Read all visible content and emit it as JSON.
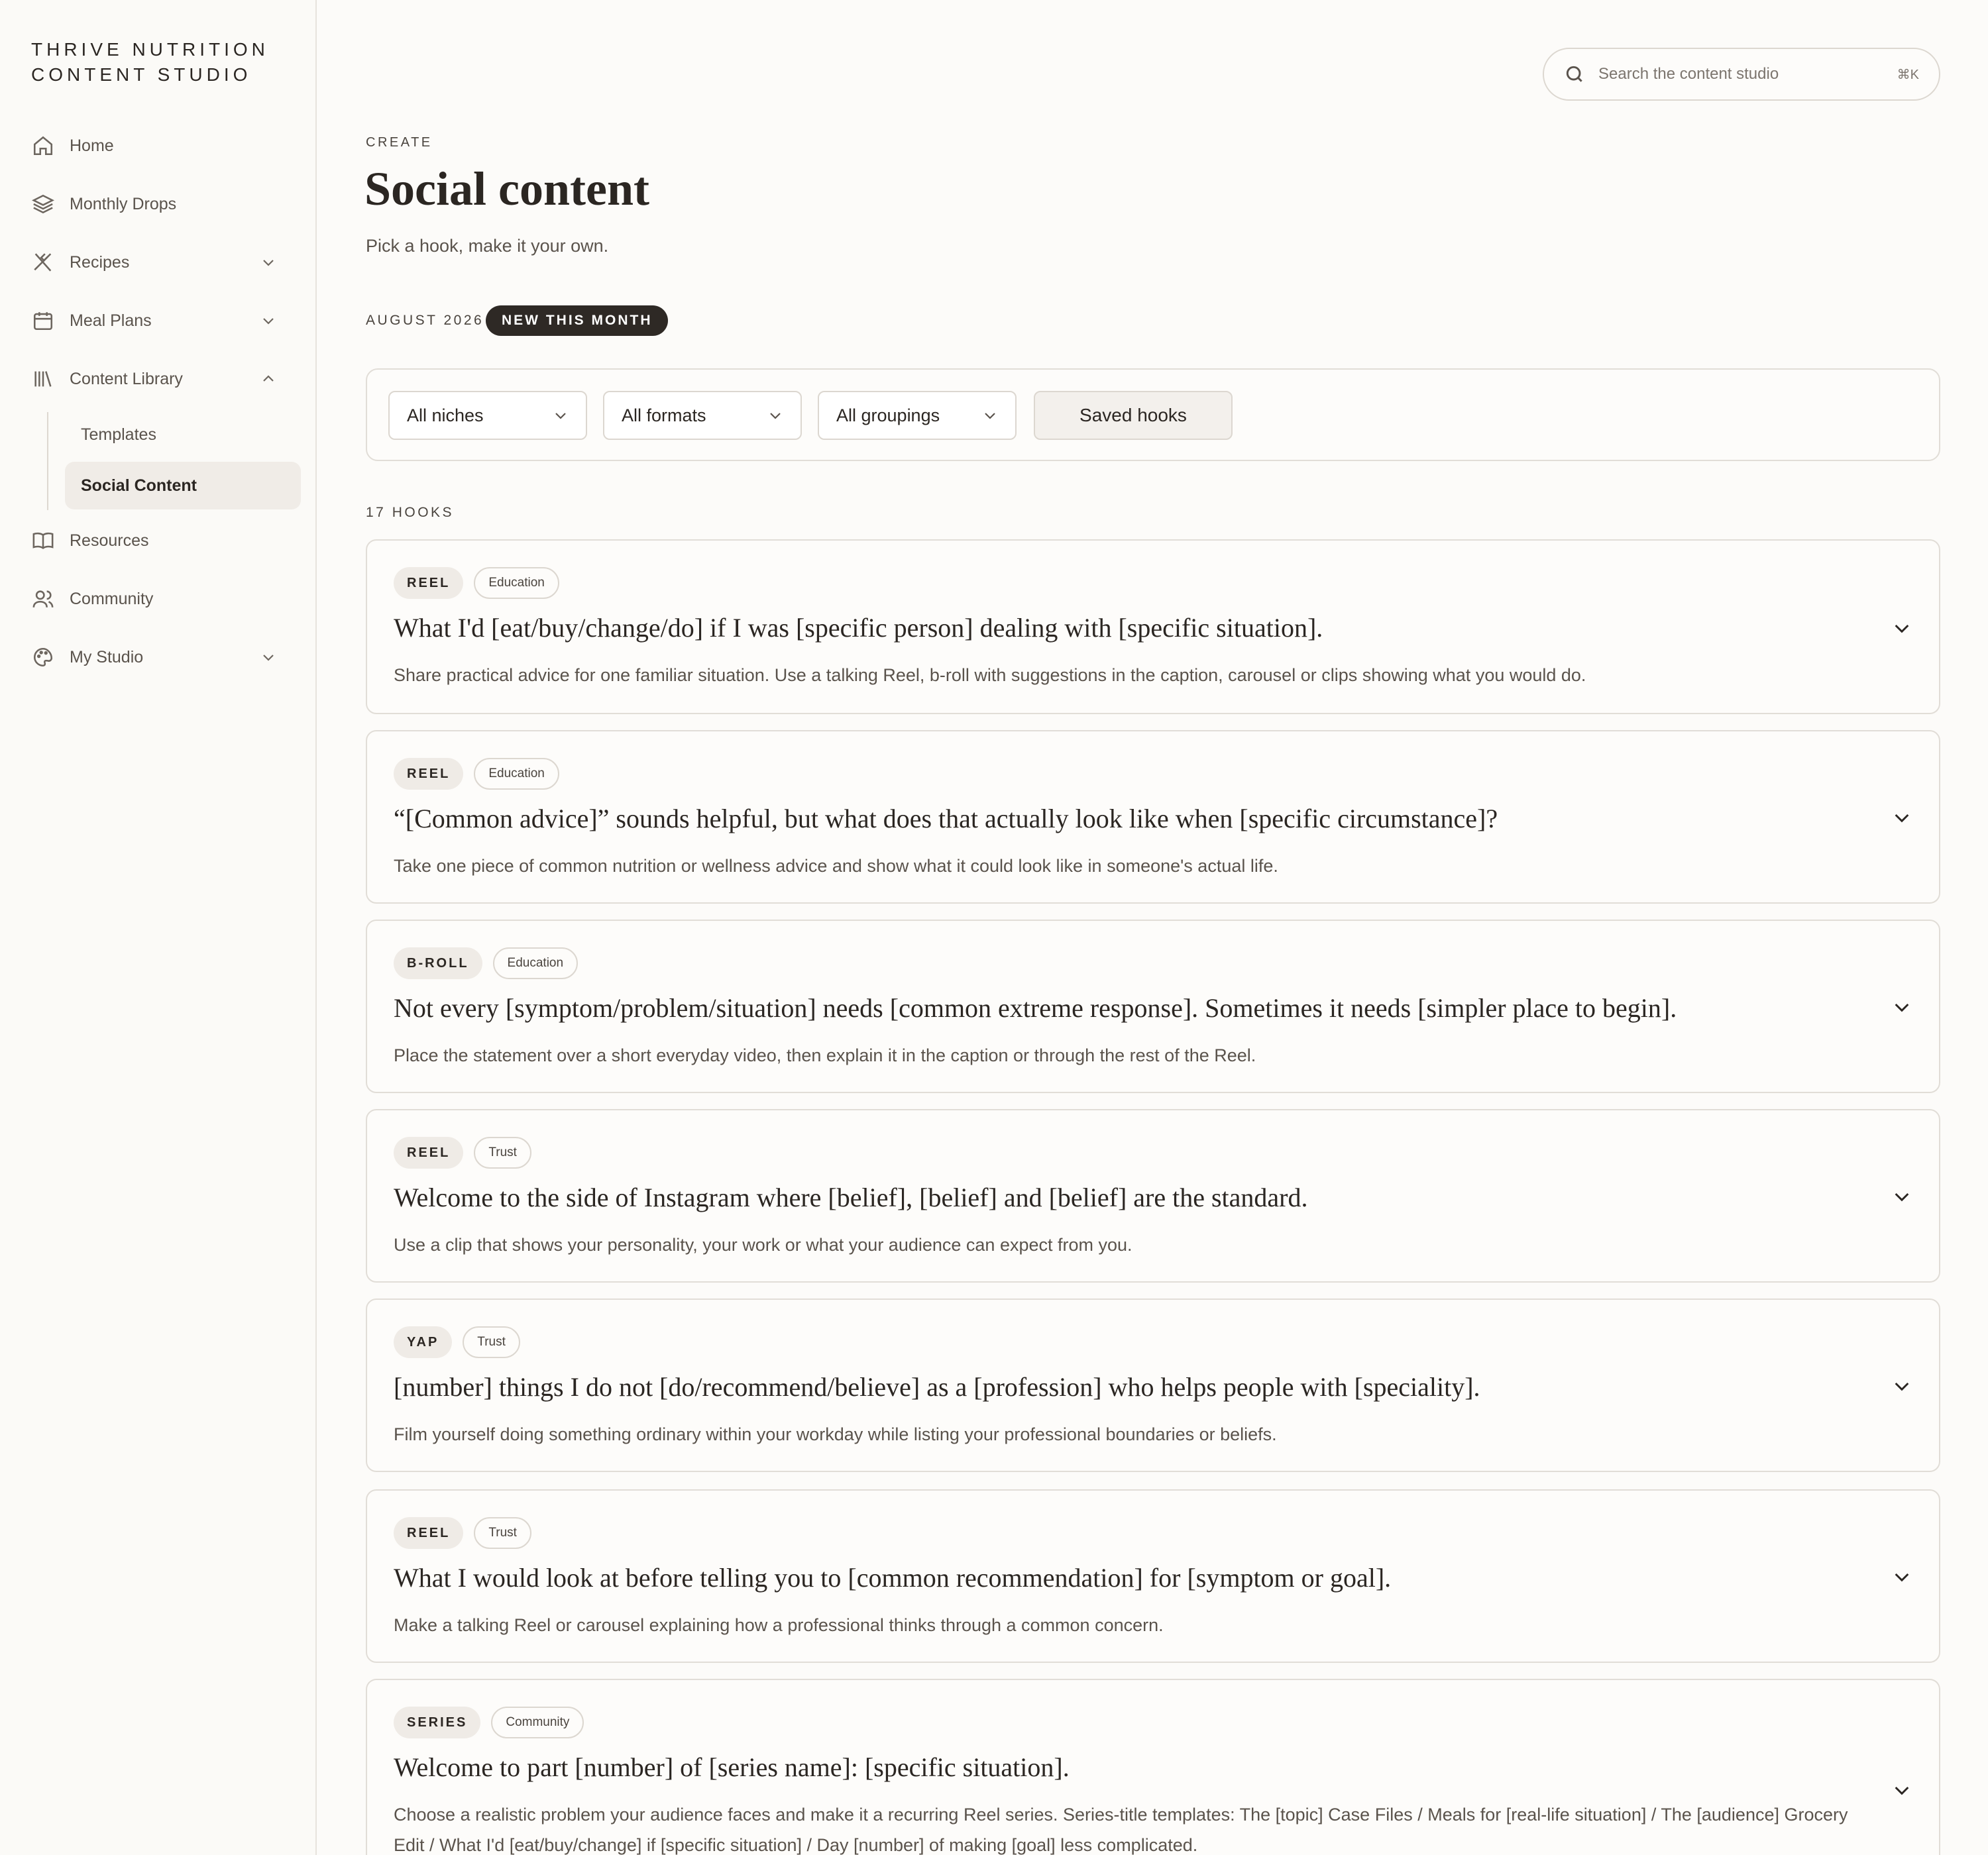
{
  "brand": {
    "line1": "THRIVE NUTRITION",
    "line2": "CONTENT STUDIO"
  },
  "sidebar": {
    "items": [
      {
        "label": "Home",
        "icon": "home-icon"
      },
      {
        "label": "Monthly Drops",
        "icon": "layers-icon"
      },
      {
        "label": "Recipes",
        "icon": "utensils-icon",
        "expandable": true
      },
      {
        "label": "Meal Plans",
        "icon": "calendar-icon",
        "expandable": true
      },
      {
        "label": "Content Library",
        "icon": "library-icon",
        "expanded": true
      },
      {
        "label": "Resources",
        "icon": "book-icon"
      },
      {
        "label": "Community",
        "icon": "users-icon"
      },
      {
        "label": "My Studio",
        "icon": "palette-icon",
        "expandable": true
      }
    ],
    "subitems": [
      {
        "label": "Templates"
      },
      {
        "label": "Social Content",
        "active": true
      }
    ]
  },
  "search": {
    "placeholder": "Search the content studio",
    "shortcut": "⌘K"
  },
  "header": {
    "eyebrow": "CREATE",
    "title": "Social content",
    "subtitle": "Pick a hook, make it your own.",
    "month": "AUGUST 2026",
    "badge": "NEW THIS MONTH"
  },
  "filters": {
    "niche": "All niches",
    "format": "All formats",
    "grouping": "All groupings",
    "saved": "Saved hooks"
  },
  "count_label": "17 HOOKS",
  "hooks": [
    {
      "format": "REEL",
      "category": "Education",
      "hook": "What I'd [eat/buy/change/do] if I was [specific person] dealing with [specific situation].",
      "desc": "Share practical advice for one familiar situation. Use a talking Reel, b-roll with suggestions in the caption, carousel or clips showing what you would do."
    },
    {
      "format": "REEL",
      "category": "Education",
      "hook": "“[Common advice]” sounds helpful, but what does that actually look like when [specific circumstance]?",
      "desc": "Take one piece of common nutrition or wellness advice and show what it could look like in someone's actual life."
    },
    {
      "format": "B-ROLL",
      "category": "Education",
      "hook": "Not every [symptom/problem/situation] needs [common extreme response]. Sometimes it needs [simpler place to begin].",
      "desc": "Place the statement over a short everyday video, then explain it in the caption or through the rest of the Reel."
    },
    {
      "format": "REEL",
      "category": "Trust",
      "hook": "Welcome to the side of Instagram where [belief], [belief] and [belief] are the standard.",
      "desc": "Use a clip that shows your personality, your work or what your audience can expect from you."
    },
    {
      "format": "YAP",
      "category": "Trust",
      "hook": "[number] things I do not [do/recommend/believe] as a [profession] who helps people with [speciality].",
      "desc": "Film yourself doing something ordinary within your workday while listing your professional boundaries or beliefs."
    },
    {
      "format": "REEL",
      "category": "Trust",
      "hook": "What I would look at before telling you to [common recommendation] for [symptom or goal].",
      "desc": "Make a talking Reel or carousel explaining how a professional thinks through a common concern."
    },
    {
      "format": "SERIES",
      "category": "Community",
      "hook": "Welcome to part [number] of [series name]: [specific situation].",
      "desc": "Choose a realistic problem your audience faces and make it a recurring Reel series. Series-title templates: The [topic] Case Files / Meals for [real-life situation] / The [audience] Grocery Edit / What I'd [eat/buy/change] if [specific situation] / Day [number] of making [goal] less complicated."
    }
  ]
}
